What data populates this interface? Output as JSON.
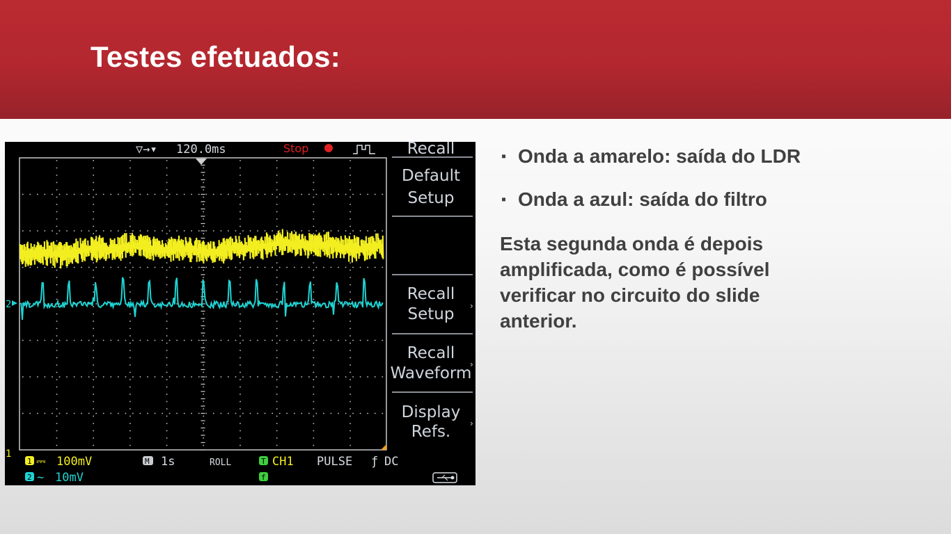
{
  "slide": {
    "title": "Testes efetuados:"
  },
  "scope": {
    "timebase_readout": "120.0ms",
    "trigger_state": "Stop",
    "menu_title": "Recall",
    "menu": [
      {
        "line1": "Default",
        "line2": "Setup"
      },
      {
        "line1": "Recall",
        "line2": "Setup"
      },
      {
        "line1": "Recall",
        "line2": "Waveform"
      },
      {
        "line1": "Display",
        "line2": "Refs."
      }
    ],
    "status": {
      "ch1_scale": "100mV",
      "ch2_scale": "10mV",
      "time_scale": "1s",
      "mode": "ROLL",
      "trigger_source": "CH1",
      "trigger_type": "PULSE",
      "coupling": "DC"
    },
    "markers": {
      "ch1": "1",
      "ch2": "2"
    },
    "colors": {
      "ch1": "#f2ee20",
      "ch2": "#1fd3d3",
      "grid": "#c8c8c8",
      "stop": "#e02020"
    },
    "icons": [
      "trigger-marker-icon",
      "pulse-trigger-icon",
      "usb-icon",
      "stop-dot-icon"
    ]
  },
  "notes": {
    "bullets": [
      "Onda a amarelo: saída do LDR",
      "Onda a azul: saída do filtro"
    ],
    "paragraph": "Esta segunda onda é depois amplificada, como é possível verificar no circuito do slide anterior."
  }
}
